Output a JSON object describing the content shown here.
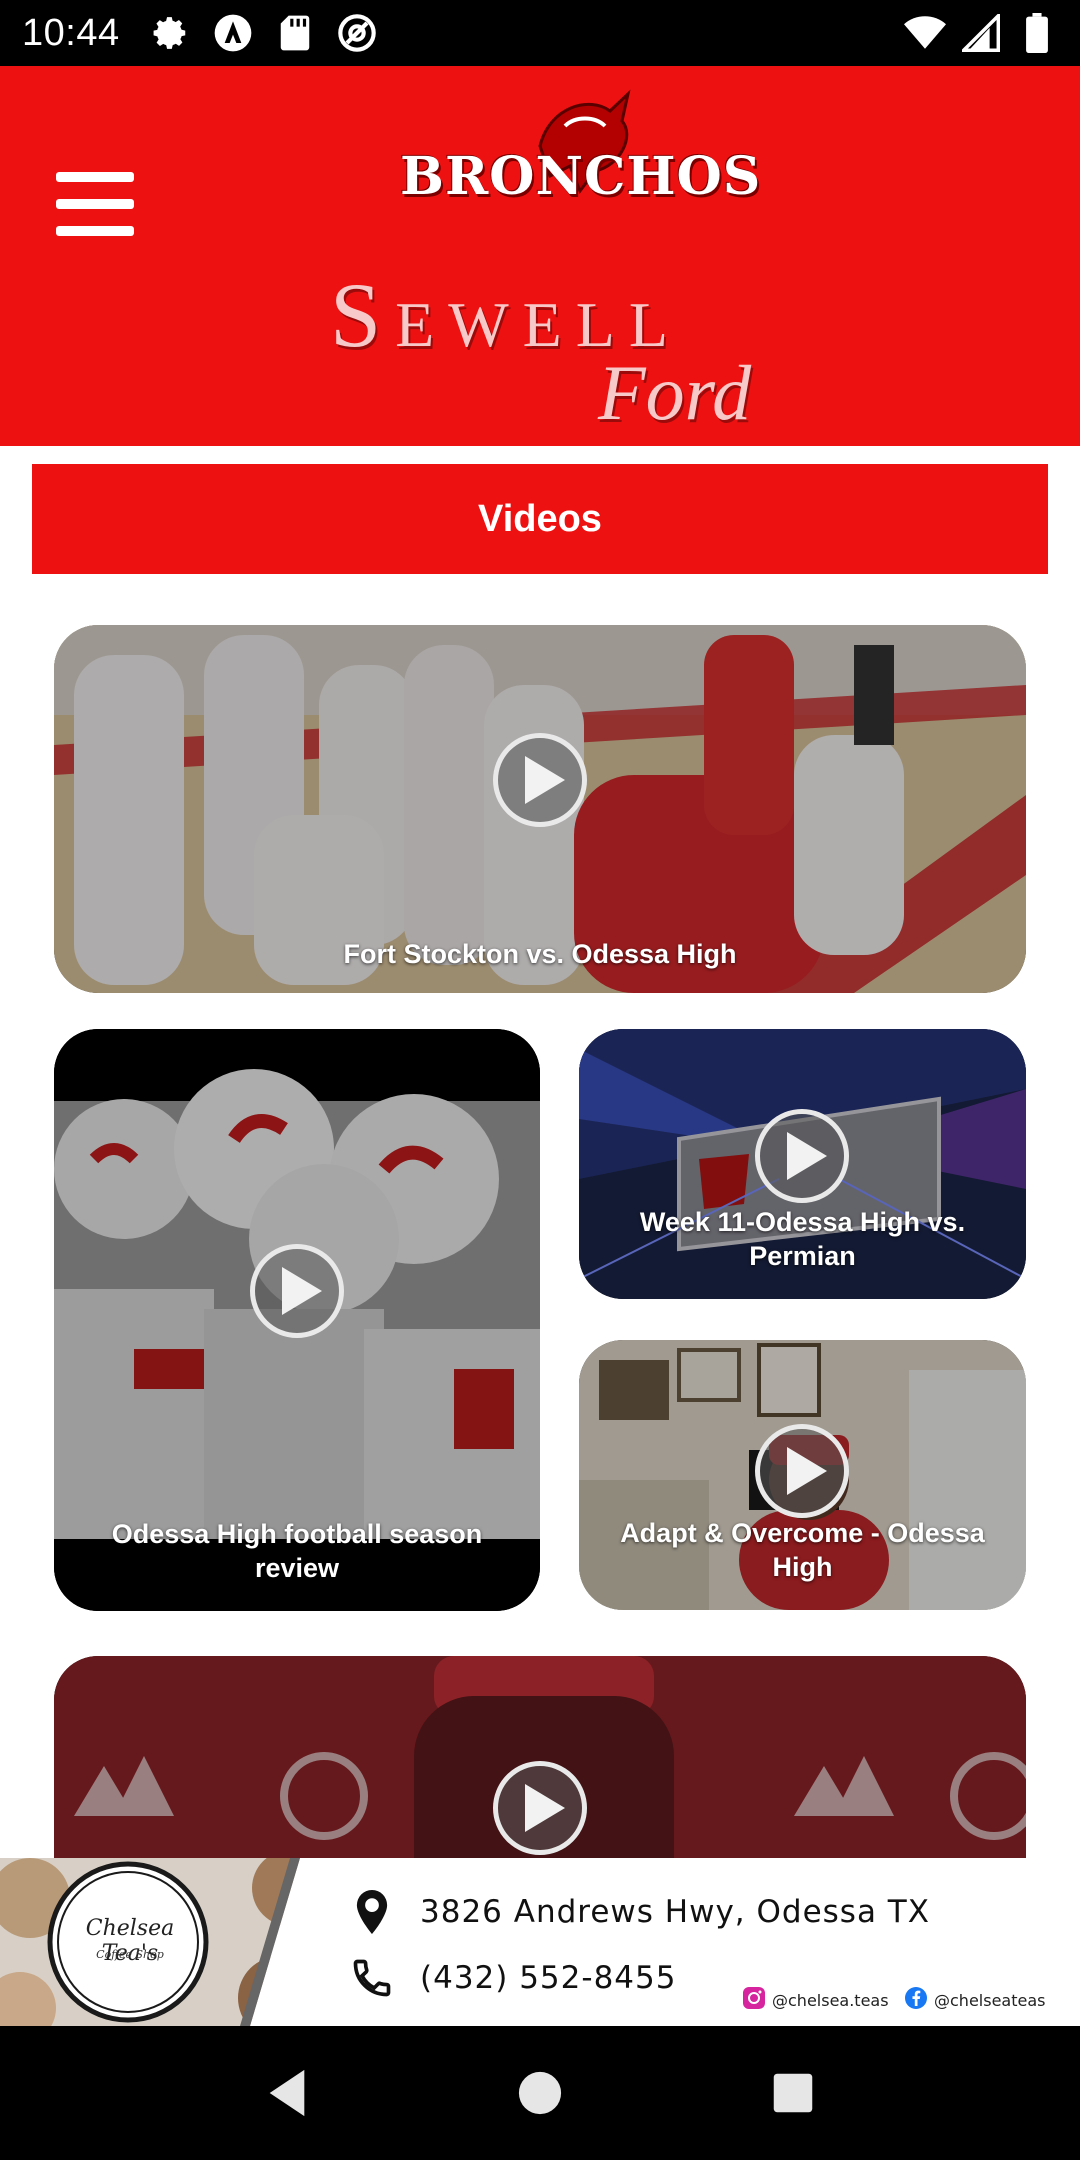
{
  "status_bar": {
    "time": "10:44",
    "left_icons": [
      "settings-icon",
      "autonavi-icon",
      "sd-card-icon",
      "no-disturb-icon"
    ],
    "right_icons": [
      "wifi-icon",
      "cell-signal-icon",
      "battery-icon"
    ]
  },
  "header": {
    "menu_icon": "hamburger-icon",
    "team_logo_text": "BRONCHOS",
    "sponsor_name": "Sewell",
    "sponsor_sub": "Ford",
    "background": "#ee1111"
  },
  "section": {
    "title": "Videos"
  },
  "videos": [
    {
      "title": "Fort Stockton vs. Odessa High"
    },
    {
      "title": "Odessa High football season review"
    },
    {
      "title": "Week 11-Odessa High vs. Permian"
    },
    {
      "title": "Adapt & Overcome - Odessa High"
    },
    {
      "title": ""
    }
  ],
  "ad": {
    "shop_name": "Chelsea Tea's",
    "shop_sub": "Coffee Shop",
    "address": "3826 Andrews Hwy, Odessa TX",
    "phone": "(432) 552-8455",
    "instagram": "@chelsea.teas",
    "facebook": "@chelseateas"
  },
  "nav": {
    "back_icon": "back-icon",
    "home_icon": "home-icon",
    "recents_icon": "recents-icon"
  }
}
